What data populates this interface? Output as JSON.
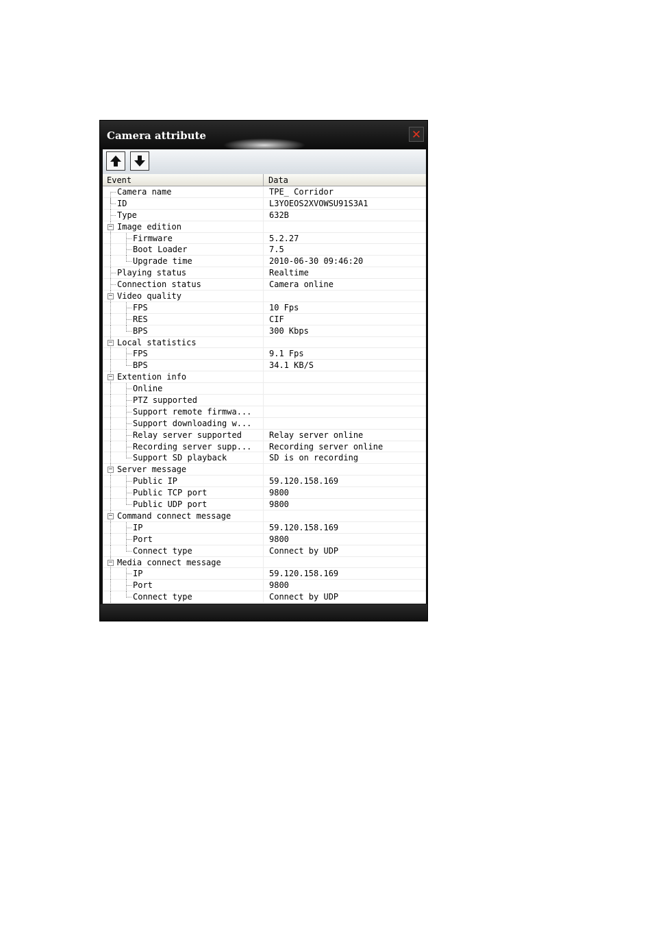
{
  "window": {
    "title": "Camera attribute",
    "close_glyph": "✕"
  },
  "toolbar": {
    "up_icon": "arrow-up-icon",
    "down_icon": "arrow-down-icon"
  },
  "table": {
    "headers": {
      "event": "Event",
      "data": "Data"
    },
    "rows": [
      {
        "level": 0,
        "expand": false,
        "event": "Camera name",
        "data": "TPE_ Corridor"
      },
      {
        "level": 0,
        "expand": false,
        "event": "ID",
        "data": "L3YOEOS2XVOWSU91S3A1"
      },
      {
        "level": 0,
        "expand": false,
        "event": "Type",
        "data": "632B"
      },
      {
        "level": 0,
        "expand": true,
        "event": "Image edition",
        "data": ""
      },
      {
        "level": 1,
        "expand": false,
        "event": "Firmware",
        "data": "5.2.27"
      },
      {
        "level": 1,
        "expand": false,
        "event": "Boot Loader",
        "data": "7.5"
      },
      {
        "level": 1,
        "expand": false,
        "event": "Upgrade time",
        "data": "2010-06-30 09:46:20"
      },
      {
        "level": 0,
        "expand": false,
        "event": "Playing status",
        "data": "Realtime"
      },
      {
        "level": 0,
        "expand": false,
        "event": "Connection status",
        "data": "Camera online"
      },
      {
        "level": 0,
        "expand": true,
        "event": "Video quality",
        "data": ""
      },
      {
        "level": 1,
        "expand": false,
        "event": "FPS",
        "data": "10 Fps"
      },
      {
        "level": 1,
        "expand": false,
        "event": "RES",
        "data": "CIF"
      },
      {
        "level": 1,
        "expand": false,
        "event": "BPS",
        "data": "300 Kbps"
      },
      {
        "level": 0,
        "expand": true,
        "event": "Local statistics",
        "data": ""
      },
      {
        "level": 1,
        "expand": false,
        "event": "FPS",
        "data": "9.1 Fps"
      },
      {
        "level": 1,
        "expand": false,
        "event": "BPS",
        "data": "34.1 KB/S"
      },
      {
        "level": 0,
        "expand": true,
        "event": "Extention info",
        "data": ""
      },
      {
        "level": 1,
        "expand": false,
        "event": "Online",
        "data": ""
      },
      {
        "level": 1,
        "expand": false,
        "event": "PTZ supported",
        "data": ""
      },
      {
        "level": 1,
        "expand": false,
        "event": "Support remote firmwa...",
        "data": ""
      },
      {
        "level": 1,
        "expand": false,
        "event": "Support downloading w...",
        "data": ""
      },
      {
        "level": 1,
        "expand": false,
        "event": "Relay server supported",
        "data": "Relay server online"
      },
      {
        "level": 1,
        "expand": false,
        "event": "Recording server supp...",
        "data": "Recording server online"
      },
      {
        "level": 1,
        "expand": false,
        "event": "Support SD playback",
        "data": "SD is on recording"
      },
      {
        "level": 0,
        "expand": true,
        "event": "Server message",
        "data": ""
      },
      {
        "level": 1,
        "expand": false,
        "event": "Public IP",
        "data": "59.120.158.169"
      },
      {
        "level": 1,
        "expand": false,
        "event": "Public TCP port",
        "data": "9800"
      },
      {
        "level": 1,
        "expand": false,
        "event": "Public UDP port",
        "data": "9800"
      },
      {
        "level": 0,
        "expand": true,
        "event": "Command connect message",
        "data": ""
      },
      {
        "level": 1,
        "expand": false,
        "event": "IP",
        "data": "59.120.158.169"
      },
      {
        "level": 1,
        "expand": false,
        "event": "Port",
        "data": "9800"
      },
      {
        "level": 1,
        "expand": false,
        "event": "Connect type",
        "data": "Connect by UDP"
      },
      {
        "level": 0,
        "expand": true,
        "event": "Media connect message",
        "data": ""
      },
      {
        "level": 1,
        "expand": false,
        "event": "IP",
        "data": "59.120.158.169"
      },
      {
        "level": 1,
        "expand": false,
        "event": "Port",
        "data": "9800"
      },
      {
        "level": 1,
        "expand": false,
        "event": "Connect type",
        "data": "Connect by UDP"
      }
    ]
  }
}
